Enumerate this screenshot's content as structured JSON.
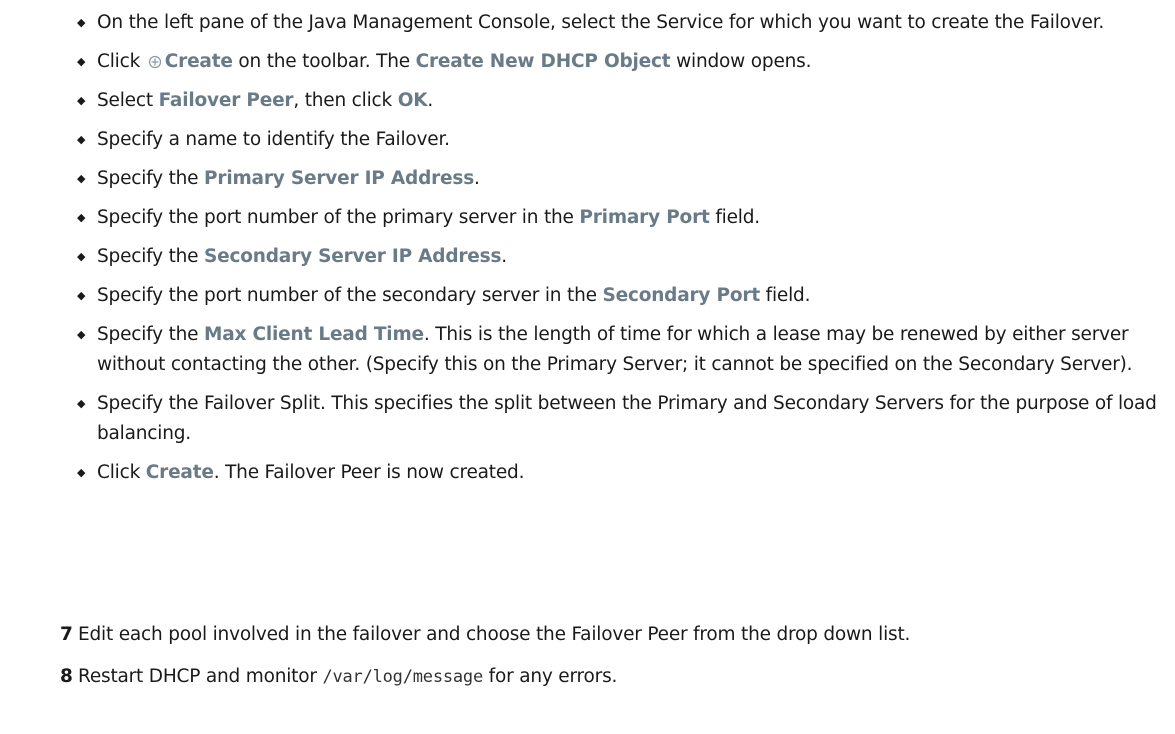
{
  "colors": {
    "text": "#1a1a1a",
    "ui_term": "#6a7b88"
  },
  "bullets": [
    {
      "text": "On the left pane of the Java Management Console, select the Service for which you want to create the Failover."
    },
    {
      "pre": "Click ",
      "icon": "create-icon",
      "term": "Create",
      "mid": " on the toolbar. The ",
      "term2": "Create New DHCP Object",
      "post": " window opens."
    },
    {
      "pre": "Select ",
      "term": "Failover Peer",
      "mid": ", then click ",
      "term2": "OK",
      "post": "."
    },
    {
      "text": "Specify a name to identify the Failover."
    },
    {
      "pre": "Specify the ",
      "term": "Primary Server IP Address",
      "post": "."
    },
    {
      "pre": "Specify the port number of the primary server in the ",
      "term": "Primary Port",
      "post": " field."
    },
    {
      "pre": "Specify the ",
      "term": "Secondary Server IP Address",
      "post": "."
    },
    {
      "pre": "Specify the port number of the secondary server in the ",
      "term": "Secondary Port",
      "post": " field."
    },
    {
      "pre": "Specify the ",
      "term": "Max Client Lead Time",
      "post": ". This is the length of time for which a lease may be renewed by either server without contacting the other. (Specify this on the Primary Server; it cannot be specified on the Secondary Server)."
    },
    {
      "text": "Specify the Failover Split. This specifies the split between the Primary and Secondary Servers for the purpose of load balancing."
    },
    {
      "pre": "Click ",
      "term": "Create",
      "post": ". The Failover Peer is now created."
    }
  ],
  "steps": [
    {
      "num": "7",
      "text": "Edit each pool involved in the failover and choose the Failover Peer from the drop down list."
    },
    {
      "num": "8",
      "pre": "Restart DHCP and monitor ",
      "code": "/var/log/message",
      "post": " for any errors."
    }
  ]
}
